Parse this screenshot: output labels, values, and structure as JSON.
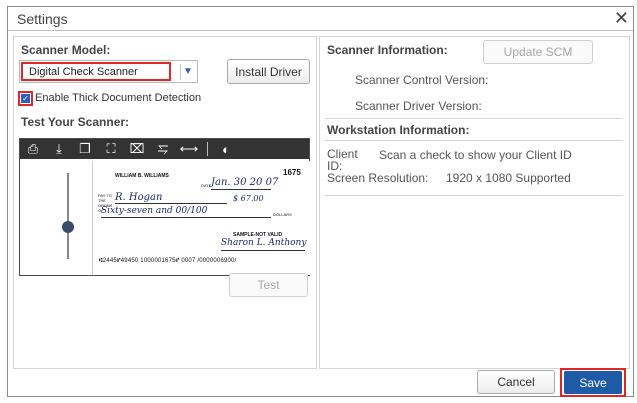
{
  "dialog": {
    "title": "Settings",
    "close_glyph": "✕"
  },
  "left": {
    "scanner_model_label": "Scanner Model:",
    "scanner_model_value": "Digital Check Scanner",
    "install_driver_label": "Install Driver",
    "thick_doc_label": "Enable Thick Document Detection",
    "thick_doc_checked": true,
    "test_scanner_label": "Test Your Scanner:",
    "test_button_label": "Test",
    "toolbar_icons": [
      "printer-icon",
      "download-icon",
      "copy-icon",
      "fit-page-icon",
      "zoom-fit-icon",
      "fit-height-icon",
      "fit-width-icon",
      "contrast-icon"
    ]
  },
  "check": {
    "number": "1675",
    "payer_name": "WILLIAM B. WILLIAMS",
    "date_label": "DATE",
    "date_value": "Jan. 30 20 07",
    "pay_to_label": "PAY TO THE ORDER OF",
    "payee": "R. Hogan",
    "amount": "$ 67.00",
    "amount_words": "Sixty-seven and 00/100",
    "dollars_label": "DOLLARS",
    "sample_text": "SAMPLE-NOT VALID",
    "signature": "Sharon L. Anthony",
    "micr_line": "⑆2445⑈49450 1000001675⑈  0007  /0000006900/"
  },
  "right": {
    "scanner_info_label": "Scanner Information:",
    "update_scm_label": "Update SCM",
    "control_version_label": "Scanner Control Version:",
    "driver_version_label": "Scanner Driver Version:",
    "workstation_info_label": "Workstation Information:",
    "client_id_label": "Client ID:",
    "client_id_value": "Scan a check to show your Client ID",
    "screen_resolution_label": "Screen Resolution:",
    "screen_resolution_value": "1920 x 1080 Supported"
  },
  "footer": {
    "cancel_label": "Cancel",
    "save_label": "Save"
  },
  "colors": {
    "accent": "#1f5aa6",
    "highlight": "#e02626",
    "checkbox": "#2b5fc0"
  }
}
